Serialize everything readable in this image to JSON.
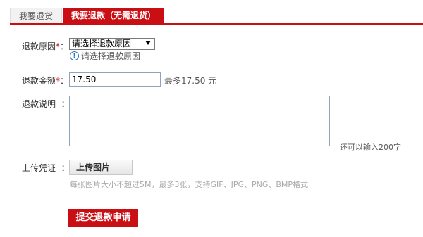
{
  "tabs": [
    {
      "label": "我要退货"
    },
    {
      "label": "我要退款（无需退货）"
    }
  ],
  "form": {
    "reason": {
      "label": "退款原因",
      "required_mark": "*",
      "colon": "：",
      "select_value": "请选择退款原因",
      "hint": "请选择退款原因"
    },
    "amount": {
      "label": "退款金额",
      "required_mark": "*",
      "colon": "：",
      "value": "17.50",
      "max_note": "最多17.50 元"
    },
    "description": {
      "label": "退款说明",
      "colon": "：",
      "value": "",
      "remaining_note": "还可以输入200字"
    },
    "upload": {
      "label": "上传凭证",
      "colon": "：",
      "button_label": "上传图片",
      "note": "每张图片大小不超过5M，最多3张，支持GIF、JPG、PNG、BMP格式"
    },
    "submit_label": "提交退款申请"
  },
  "colors": {
    "accent": "#c90f14",
    "input_border": "#8fa3bf",
    "info_icon": "#2a6fbf"
  },
  "icons": {
    "hint": "info-circle-icon",
    "select": "dropdown-arrow-icon"
  }
}
